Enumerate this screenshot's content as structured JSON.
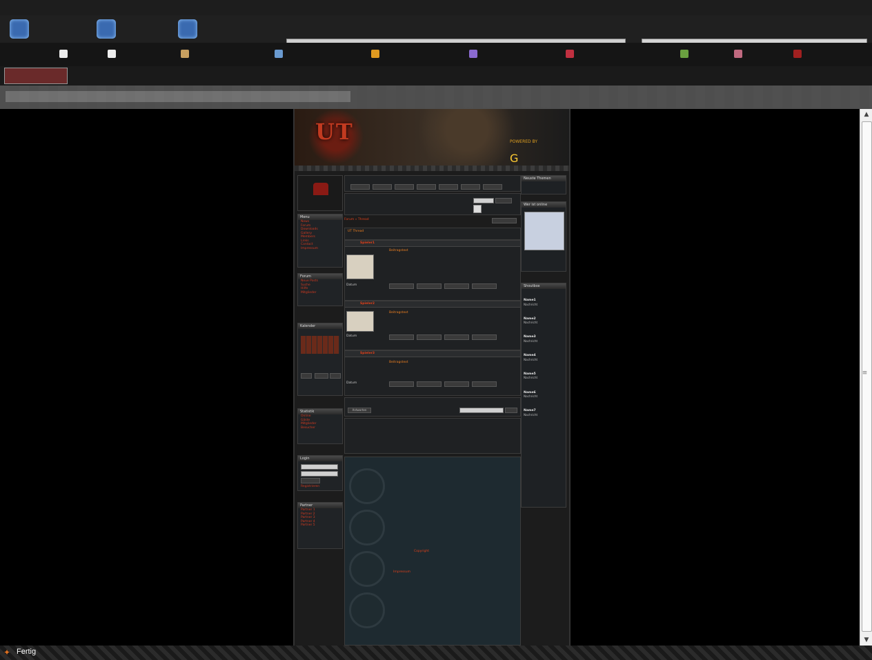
{
  "status": {
    "text": "Fertig"
  },
  "site": {
    "sponsor_line1": "POWERED BY",
    "left_boxes": [
      {
        "title": "Menu",
        "links": [
          "News",
          "Forum",
          "Downloads",
          "Gallery",
          "Members",
          "Links",
          "Contact",
          "Impressum"
        ]
      },
      {
        "title": "Forum",
        "links": [
          "Neue Posts",
          "Suche",
          "Hilfe",
          "Mitglieder"
        ]
      },
      {
        "title": "Kalender",
        "links": []
      },
      {
        "title": "Statistik",
        "links": [
          "Online",
          "Gäste",
          "Mitglieder",
          "Besucher"
        ]
      },
      {
        "title": "Login",
        "links": [
          "Registrieren",
          "Passwort vergessen"
        ]
      },
      {
        "title": "Partner",
        "links": [
          "Partner 1",
          "Partner 2",
          "Partner 3",
          "Partner 4",
          "Partner 5"
        ]
      }
    ],
    "main": {
      "breadcrumb": "Forum » Thread",
      "thread_title": "UT Thread",
      "reply_button": "Antworten",
      "posts": [
        {
          "author": "Spieler1",
          "text": "Beitragstext",
          "date": "Datum"
        },
        {
          "author": "Spieler2",
          "text": "Beitragstext",
          "date": "Datum"
        },
        {
          "author": "Spieler3",
          "text": "Beitragstext",
          "date": "Datum"
        }
      ],
      "footer_line1": "Copyright",
      "footer_line2": "Impressum"
    },
    "right_boxes": [
      {
        "title": "Neuste Themen"
      },
      {
        "title": "Wer ist online"
      },
      {
        "title": "Shoutbox"
      }
    ],
    "shoutbox": [
      {
        "name": "Name1",
        "text": "Nachricht"
      },
      {
        "name": "Name2",
        "text": "Nachricht"
      },
      {
        "name": "Name3",
        "text": "Nachricht"
      },
      {
        "name": "Name4",
        "text": "Nachricht"
      },
      {
        "name": "Name5",
        "text": "Nachricht"
      },
      {
        "name": "Name6",
        "text": "Nachricht"
      },
      {
        "name": "Name7",
        "text": "Nachricht"
      }
    ]
  }
}
